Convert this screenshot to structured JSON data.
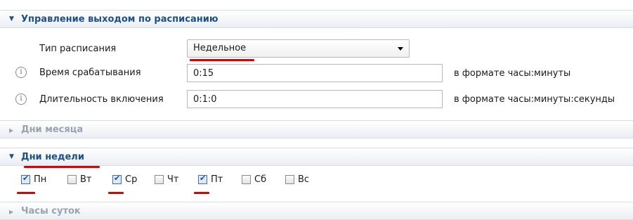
{
  "sections": {
    "schedule": {
      "title": "Управление выходом по расписанию",
      "expanded": true
    },
    "month_days": {
      "title": "Дни месяца",
      "expanded": false
    },
    "week_days": {
      "title": "Дни недели",
      "expanded": true
    },
    "day_hours": {
      "title": "Часы суток",
      "expanded": false
    }
  },
  "schedule": {
    "type_label": "Тип расписания",
    "type_value": "Недельное",
    "trigger_time_label": "Время срабатывания",
    "trigger_time_value": "0:15",
    "trigger_time_hint": "в формате часы:минуты",
    "duration_label": "Длительность включения",
    "duration_value": "0:1:0",
    "duration_hint": "в формате часы:минуты:секунды",
    "info_glyph": "i"
  },
  "week_days": [
    {
      "label": "Пн",
      "checked": true
    },
    {
      "label": "Вт",
      "checked": false
    },
    {
      "label": "Ср",
      "checked": true
    },
    {
      "label": "Чт",
      "checked": false
    },
    {
      "label": "Пт",
      "checked": true
    },
    {
      "label": "Сб",
      "checked": false
    },
    {
      "label": "Вс",
      "checked": false
    }
  ],
  "glyphs": {
    "expanded": "▼",
    "collapsed": "▶",
    "check": "✔"
  },
  "colors": {
    "header_text": "#1e4f86",
    "collapsed_text": "#9aa3ad",
    "annotation": "#e00000"
  }
}
